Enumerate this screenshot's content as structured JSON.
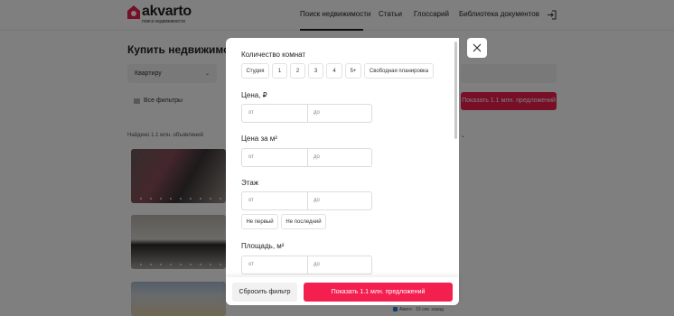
{
  "header": {
    "logo_text": "akvarto",
    "logo_tagline": "поиск недвижимости",
    "brand_color": "#ee1e4e",
    "nav": [
      {
        "label": "Поиск недвижимости",
        "active": true
      },
      {
        "label": "Статьи",
        "active": false
      },
      {
        "label": "Глоссарий",
        "active": false
      },
      {
        "label": "Библиотека документов",
        "active": false
      }
    ],
    "login_icon": "login-icon"
  },
  "background": {
    "page_title": "Купить недвижимость",
    "deal_select_value": "Квартиру",
    "filters_button_label": "Все фильтры",
    "show_button_label": "Показать 1.1 млн. предложений",
    "found_text": "Найдено 1.1 млн. объявлений",
    "listing_meta": "Авито · 15 сек. назад"
  },
  "modal": {
    "rooms": {
      "title": "Количество комнат",
      "options": [
        "Студия",
        "1",
        "2",
        "3",
        "4",
        "5+",
        "Свободная планировка"
      ]
    },
    "price": {
      "title": "Цена, ₽",
      "from_placeholder": "от",
      "to_placeholder": "до"
    },
    "price_per_m2": {
      "title": "Цена за м²",
      "from_placeholder": "от",
      "to_placeholder": "до"
    },
    "floor": {
      "title": "Этаж",
      "from_placeholder": "от",
      "to_placeholder": "до",
      "options": [
        "Не первый",
        "Не последний"
      ]
    },
    "area": {
      "title": "Площадь, м²",
      "from_placeholder": "от",
      "to_placeholder": "до"
    },
    "footer": {
      "reset_label": "Сбросить фильтр",
      "apply_label": "Показать 1.1 млн. предложений"
    },
    "close_icon": "close-icon"
  }
}
